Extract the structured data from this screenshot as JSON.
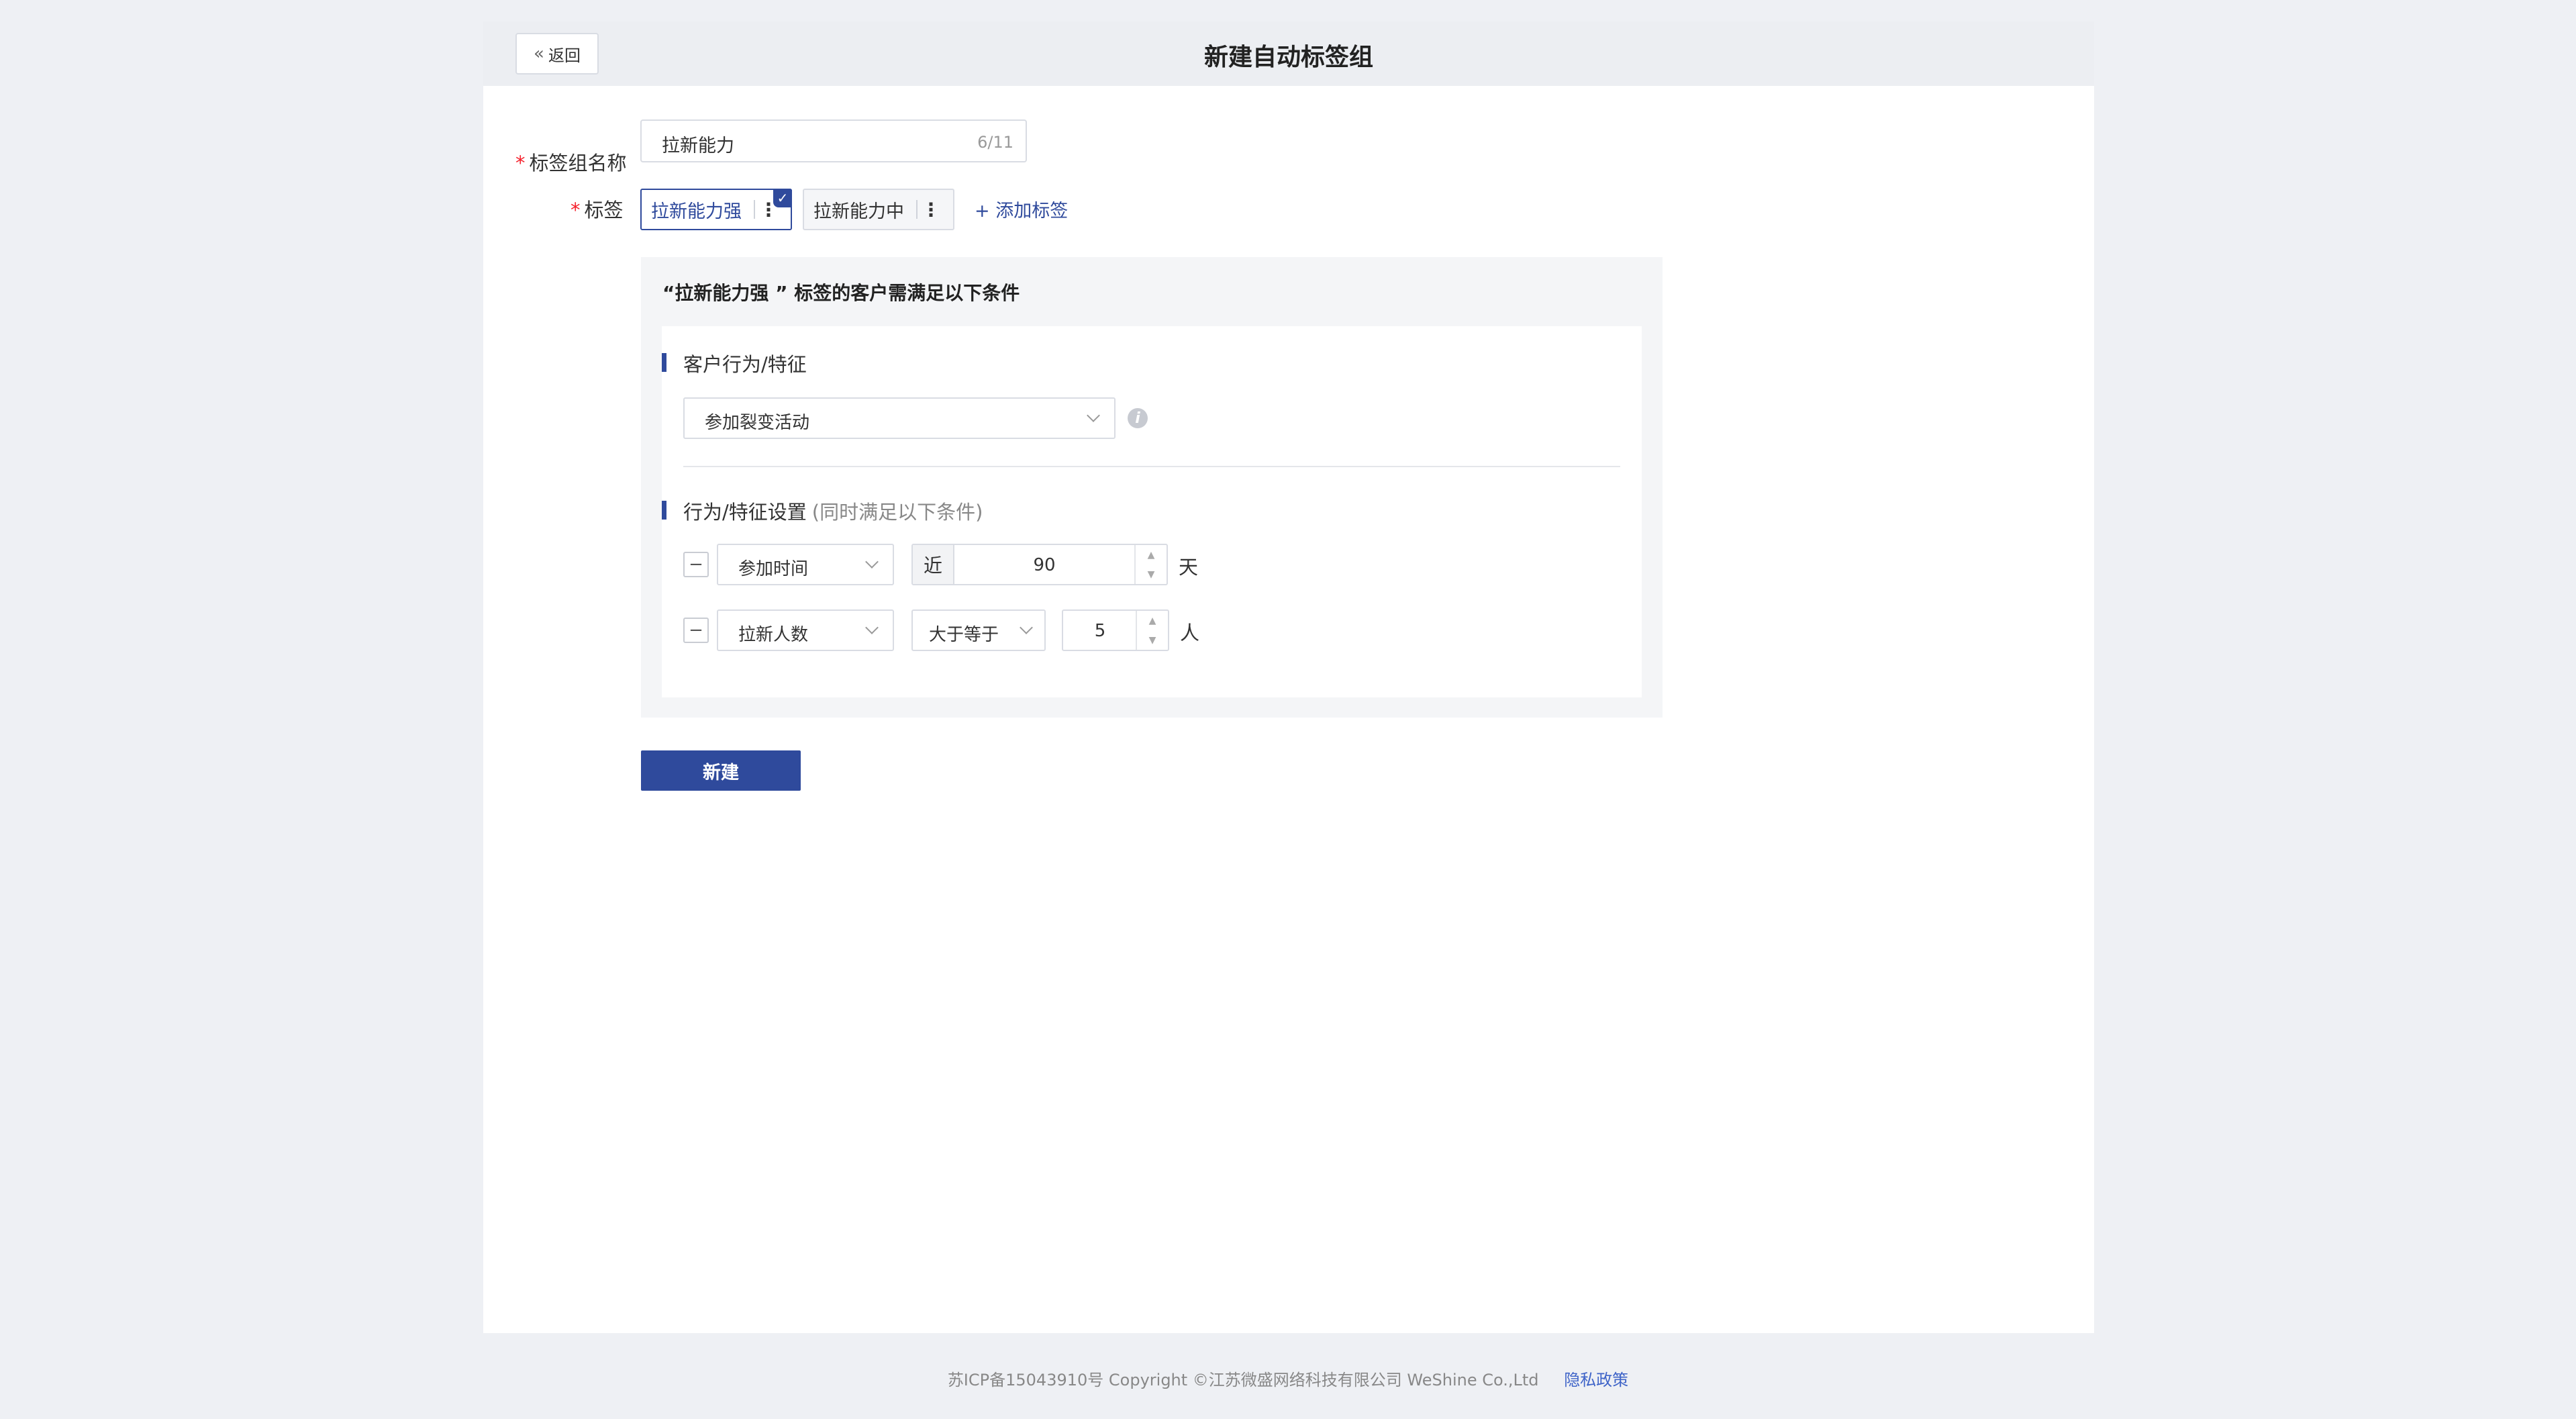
{
  "header": {
    "back_label": "返回",
    "title": "新建自动标签组"
  },
  "form": {
    "name_label": "标签组名称",
    "name_value": "拉新能力",
    "name_count": "6/11",
    "tags_label": "标签",
    "tags": [
      {
        "label": "拉新能力强",
        "selected": true
      },
      {
        "label": "拉新能力中",
        "selected": false
      }
    ],
    "add_tag_label": "+ 添加标签"
  },
  "condition": {
    "title": "“拉新能力强 ” 标签的客户需满足以下条件",
    "behavior_section_title": "客户行为/特征",
    "behavior_value": "参加裂变活动",
    "settings_section_title": "行为/特征设置",
    "settings_hint": "(同时满足以下条件)",
    "rows": [
      {
        "field": "参加时间",
        "prefix": "近",
        "value": "90",
        "unit": "天"
      },
      {
        "field": "拉新人数",
        "operator": "大于等于",
        "value": "5",
        "unit": "人"
      }
    ]
  },
  "actions": {
    "create_label": "新建"
  },
  "footer": {
    "copyright": "苏ICP备15043910号 Copyright ©江苏微盛网络科技有限公司 WeShine Co.,Ltd",
    "privacy_link": "隐私政策"
  },
  "colors": {
    "primary": "#2f4a9c",
    "required": "#f5222d",
    "link": "#3f64c8"
  }
}
